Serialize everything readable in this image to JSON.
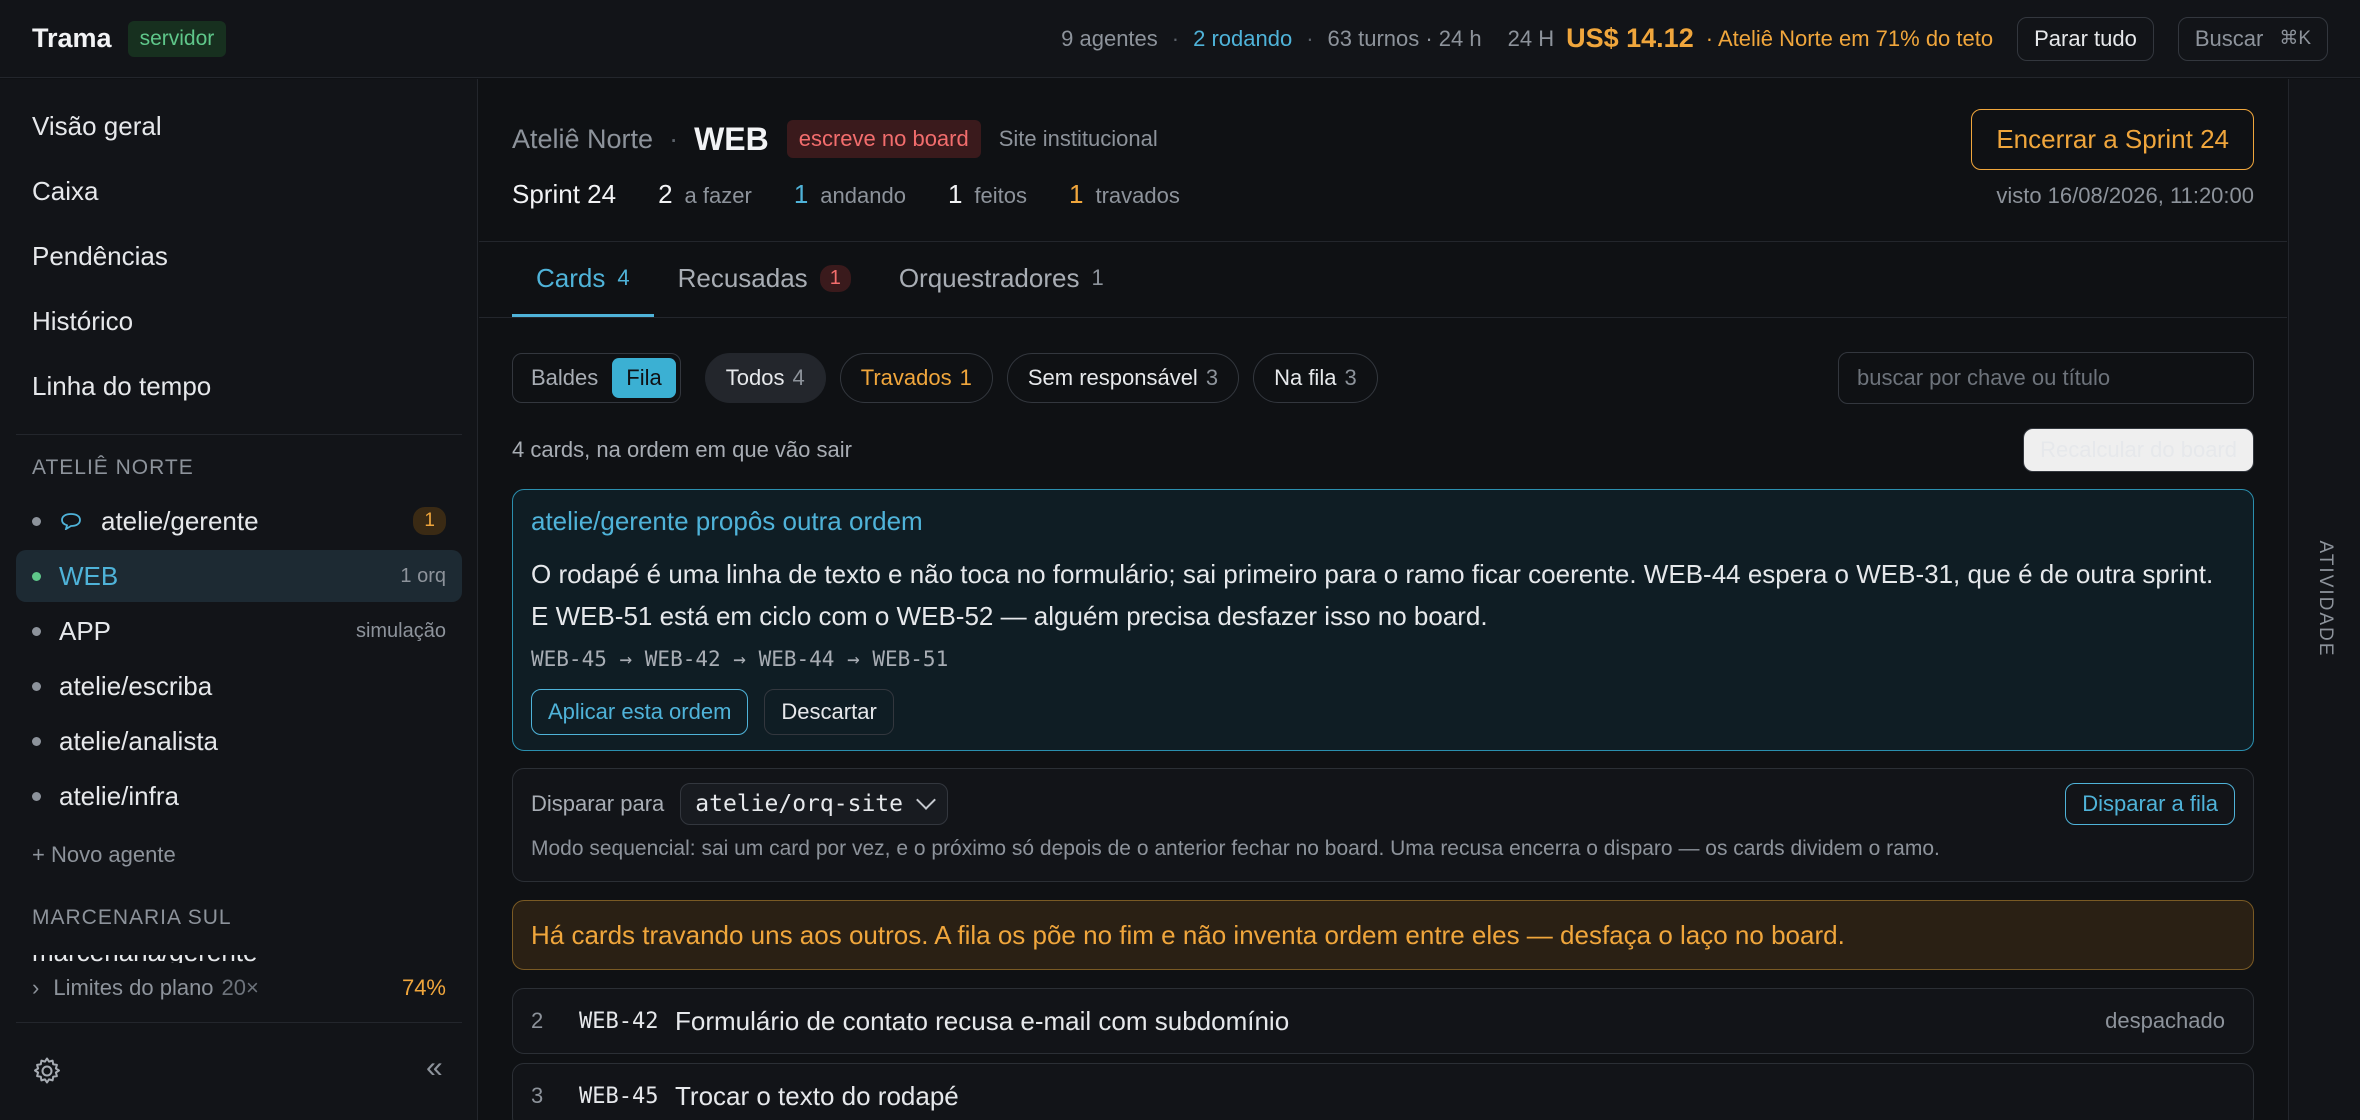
{
  "topbar": {
    "brand": "Trama",
    "env_badge": "servidor",
    "agents": "9 agentes",
    "running": "2 rodando",
    "turns": "63 turnos · 24 h",
    "cost_period": "24 H",
    "cost": "US$ 14.12",
    "cost_note": "· Ateliê Norte em 71% do teto",
    "stop_all": "Parar tudo",
    "search": "Buscar",
    "search_shortcut": "⌘K"
  },
  "sidebar": {
    "nav": [
      "Visão geral",
      "Caixa",
      "Pendências",
      "Histórico",
      "Linha do tempo"
    ],
    "groups": [
      {
        "title": "ATELIÊ NORTE",
        "agents": [
          {
            "name": "atelie/gerente",
            "badge": "1"
          },
          {
            "name": "WEB",
            "meta": "1 orq"
          },
          {
            "name": "APP",
            "meta": "simulação"
          },
          {
            "name": "atelie/escriba"
          },
          {
            "name": "atelie/analista"
          },
          {
            "name": "atelie/infra"
          }
        ],
        "new_agent": "+ Novo agente"
      },
      {
        "title": "MARCENARIA SUL",
        "clipped": "marcenaria/gerente"
      }
    ],
    "plan": {
      "label": "Limites do plano",
      "multiplier": "20×",
      "percent": "74%"
    }
  },
  "board": {
    "workspace": "Ateliê Norte",
    "name": "WEB",
    "badge": "escreve no board",
    "subtitle": "Site institucional",
    "end_sprint": "Encerrar a Sprint 24",
    "sprint": "Sprint 24",
    "stats": [
      {
        "count": "2",
        "label": "a fazer"
      },
      {
        "count": "1",
        "label": "andando"
      },
      {
        "count": "1",
        "label": "feitos"
      },
      {
        "count": "1",
        "label": "travados"
      }
    ],
    "seen": "visto 16/08/2026, 11:20:00"
  },
  "tabs": [
    {
      "label": "Cards",
      "count": "4"
    },
    {
      "label": "Recusadas",
      "count": "1"
    },
    {
      "label": "Orquestradores",
      "count": "1"
    }
  ],
  "filters": {
    "view_options": [
      "Baldes",
      "Fila"
    ],
    "view_selected": "Fila",
    "chips": [
      {
        "label": "Todos",
        "count": "4"
      },
      {
        "label": "Travados",
        "count": "1"
      },
      {
        "label": "Sem responsável",
        "count": "3"
      },
      {
        "label": "Na fila",
        "count": "3"
      }
    ],
    "search_placeholder": "buscar por chave ou título"
  },
  "queue": {
    "summary": "4 cards, na ordem em que vão sair",
    "recalc": "Recalcular do board",
    "proposal": {
      "title": "atelie/gerente propôs outra ordem",
      "body": "O rodapé é uma linha de texto e não toca no formulário; sai primeiro para o ramo ficar coerente. WEB-44 espera o WEB-31, que é de outra sprint. E WEB-51 está em ciclo com o WEB-52 — alguém precisa desfazer isso no board.",
      "sequence": "WEB-45 → WEB-42 → WEB-44 → WEB-51",
      "apply": "Aplicar esta ordem",
      "discard": "Descartar"
    },
    "dispatch": {
      "label": "Disparar para",
      "target": "atelie/orq-site",
      "button": "Disparar a fila",
      "note": "Modo sequencial: sai um card por vez, e o próximo só depois de o anterior fechar no board. Uma recusa encerra o disparo — os cards dividem o ramo."
    },
    "alert": "Há cards travando uns aos outros. A fila os põe no fim e não inventa ordem entre eles — desfaça o laço no board.",
    "cards": [
      {
        "idx": "2",
        "key": "WEB-42",
        "title": "Formulário de contato recusa e-mail com subdomínio",
        "status": "despachado"
      },
      {
        "idx": "3",
        "key": "WEB-45",
        "title": "Trocar o texto do rodapé",
        "status": ""
      }
    ]
  },
  "rail": {
    "label": "ATIVIDADE"
  },
  "colors": {
    "accent": "#4fb3d9",
    "warning": "#f0a63c",
    "danger": "#f26d6d",
    "ok": "#5fc78a"
  }
}
